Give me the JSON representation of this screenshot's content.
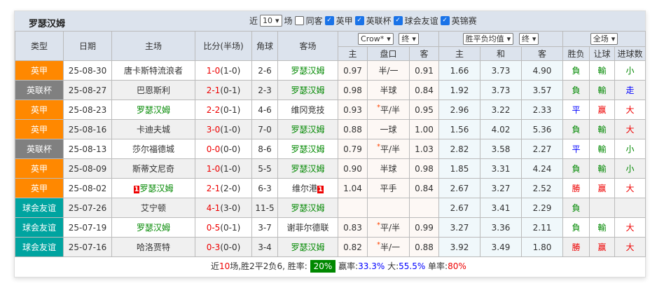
{
  "title": "罗瑟汉姆",
  "controls": {
    "near": "近",
    "count": "10",
    "unit": "场",
    "same_away": "同客",
    "filters": [
      "英甲",
      "英联杯",
      "球会友谊",
      "英锦赛"
    ]
  },
  "headers": {
    "type": "类型",
    "date": "日期",
    "home": "主场",
    "score": "比分(半场)",
    "corner": "角球",
    "away": "客场",
    "company": "Crow*",
    "final1": "终",
    "avg": "胜平负均值",
    "final2": "终",
    "scope": "全场",
    "sub": [
      "主",
      "盘口",
      "客",
      "主",
      "和",
      "客",
      "胜负",
      "让球",
      "进球数"
    ]
  },
  "league_colors": {
    "英甲": "#ff8800",
    "英联杯": "#808080",
    "球会友谊": "#00a4a0"
  },
  "rows": [
    {
      "type": "英甲",
      "date": "25-08-30",
      "home": "唐卡斯特流浪者",
      "ft": "1-0",
      "ht": "(1-0)",
      "corner": "2-6",
      "away": "罗瑟汉姆",
      "hg": false,
      "ag": true,
      "o1": "0.97",
      "line": "半/一",
      "star": false,
      "o2": "0.91",
      "w": "1.66",
      "d": "3.73",
      "l": "4.90",
      "res": "負",
      "ah": "輸",
      "ou": "小"
    },
    {
      "type": "英联杯",
      "date": "25-08-27",
      "home": "巴恩斯利",
      "ft": "2-1",
      "ht": "(0-1)",
      "corner": "2-3",
      "away": "罗瑟汉姆",
      "hg": false,
      "ag": true,
      "o1": "0.98",
      "line": "半球",
      "star": false,
      "o2": "0.84",
      "w": "1.92",
      "d": "3.73",
      "l": "3.57",
      "res": "負",
      "ah": "輸",
      "ou": "走"
    },
    {
      "type": "英甲",
      "date": "25-08-23",
      "home": "罗瑟汉姆",
      "ft": "2-2",
      "ht": "(0-1)",
      "corner": "4-6",
      "away": "维冈竞技",
      "hg": true,
      "ag": false,
      "o1": "0.93",
      "line": "平/半",
      "star": true,
      "o2": "0.95",
      "w": "2.96",
      "d": "3.22",
      "l": "2.33",
      "res": "平",
      "ah": "赢",
      "ou": "大"
    },
    {
      "type": "英甲",
      "date": "25-08-16",
      "home": "卡迪夫城",
      "ft": "3-0",
      "ht": "(1-0)",
      "corner": "7-0",
      "away": "罗瑟汉姆",
      "hg": false,
      "ag": true,
      "o1": "0.88",
      "line": "一球",
      "star": false,
      "o2": "1.00",
      "w": "1.56",
      "d": "4.02",
      "l": "5.36",
      "res": "負",
      "ah": "輸",
      "ou": "大"
    },
    {
      "type": "英联杯",
      "date": "25-08-13",
      "home": "莎尔福德城",
      "ft": "0-0",
      "ht": "(0-0)",
      "corner": "8-6",
      "away": "罗瑟汉姆",
      "hg": false,
      "ag": true,
      "o1": "0.79",
      "line": "平/半",
      "star": true,
      "o2": "1.03",
      "w": "2.82",
      "d": "3.58",
      "l": "2.27",
      "res": "平",
      "ah": "輸",
      "ou": "小"
    },
    {
      "type": "英甲",
      "date": "25-08-09",
      "home": "斯蒂文尼奇",
      "ft": "1-0",
      "ht": "(1-0)",
      "corner": "5-5",
      "away": "罗瑟汉姆",
      "hg": false,
      "ag": true,
      "o1": "0.90",
      "line": "半球",
      "star": false,
      "o2": "0.98",
      "w": "1.85",
      "d": "3.31",
      "l": "4.24",
      "res": "負",
      "ah": "輸",
      "ou": "小"
    },
    {
      "type": "英甲",
      "date": "25-08-02",
      "home": "罗瑟汉姆",
      "home_badge": "1",
      "ft": "2-1",
      "ht": "(2-0)",
      "corner": "6-3",
      "away": "维尔港",
      "away_badge": "1",
      "hg": true,
      "ag": false,
      "o1": "1.04",
      "line": "平手",
      "star": false,
      "o2": "0.84",
      "w": "2.67",
      "d": "3.27",
      "l": "2.52",
      "res": "勝",
      "ah": "赢",
      "ou": "大"
    },
    {
      "type": "球会友谊",
      "date": "25-07-26",
      "home": "艾宁顿",
      "ft": "4-1",
      "ht": "(3-0)",
      "corner": "11-5",
      "away": "罗瑟汉姆",
      "hg": false,
      "ag": true,
      "o1": "",
      "line": "",
      "star": false,
      "o2": "",
      "w": "2.67",
      "d": "3.41",
      "l": "2.29",
      "res": "負",
      "ah": "",
      "ou": ""
    },
    {
      "type": "球会友谊",
      "date": "25-07-19",
      "home": "罗瑟汉姆",
      "ft": "0-5",
      "ht": "(0-1)",
      "corner": "3-7",
      "away": "谢菲尔德联",
      "hg": true,
      "ag": false,
      "o1": "0.83",
      "line": "平/半",
      "star": true,
      "o2": "0.99",
      "w": "3.27",
      "d": "3.36",
      "l": "2.11",
      "res": "負",
      "ah": "輸",
      "ou": "大"
    },
    {
      "type": "球会友谊",
      "date": "25-07-16",
      "home": "哈洛贾特",
      "ft": "0-3",
      "ht": "(0-0)",
      "corner": "3-4",
      "away": "罗瑟汉姆",
      "hg": false,
      "ag": true,
      "o1": "0.82",
      "line": "半/一",
      "star": true,
      "o2": "0.88",
      "w": "3.92",
      "d": "3.49",
      "l": "1.80",
      "res": "勝",
      "ah": "赢",
      "ou": "大"
    }
  ],
  "summary": {
    "p1": "近",
    "n": "10",
    "p2": "场,胜",
    "win": "2",
    "p3": "平",
    "draw": "2",
    "p4": "负",
    "loss": "6",
    "p5": ", 胜率:",
    "win_rate": "20%",
    "p6": " 赢率:",
    "ah_rate": "33.3%",
    "p7": " 大:",
    "big_rate": "55.5%",
    "p8": " 单率:",
    "odd_rate": "80%"
  }
}
